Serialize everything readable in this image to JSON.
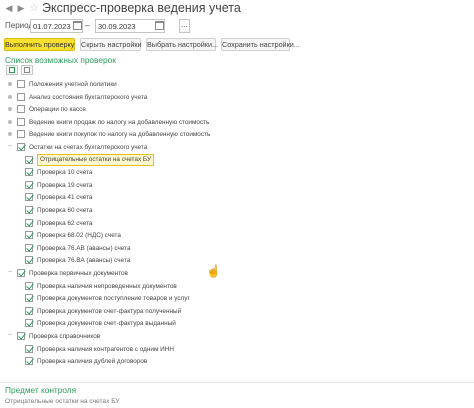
{
  "window": {
    "title": "Экспресс-проверка ведения учета",
    "star_glyph": "☆"
  },
  "period": {
    "label": "Период:",
    "from": "01.07.2023",
    "to": "30.09.2023",
    "dash": "–",
    "more": "..."
  },
  "toolbar": {
    "run": "Выполнить проверку",
    "hide": "Скрыть настройки",
    "choose": "Выбрать настройки...",
    "save": "Сохранить настройки..."
  },
  "checks_title": "Список возможных проверок",
  "tree": [
    {
      "label": "Положения учетной политики",
      "checked": false,
      "level": 0
    },
    {
      "label": "Анализ состояния бухгалтерского учета",
      "checked": false,
      "level": 0
    },
    {
      "label": "Операции по кассе",
      "checked": false,
      "level": 0
    },
    {
      "label": "Ведение книги продаж по налогу на добавленную стоимость",
      "checked": false,
      "level": 0
    },
    {
      "label": "Ведение книги покупок по налогу на добавленную стоимость",
      "checked": false,
      "level": 0
    },
    {
      "label": "Остатки на счетах бухгалтерского учета",
      "checked": true,
      "level": 0,
      "toggle": "−"
    },
    {
      "label": "Отрицательные остатки на счетах БУ",
      "checked": true,
      "level": 1,
      "selected": true
    },
    {
      "label": "Проверка 10 счета",
      "checked": true,
      "level": 1
    },
    {
      "label": "Проверка 19 счета",
      "checked": true,
      "level": 1
    },
    {
      "label": "Проверка 41 счета",
      "checked": true,
      "level": 1
    },
    {
      "label": "Проверка 60 счета",
      "checked": true,
      "level": 1
    },
    {
      "label": "Проверка 62 счета",
      "checked": true,
      "level": 1
    },
    {
      "label": "Проверка 68.02 (НДС) счета",
      "checked": true,
      "level": 1
    },
    {
      "label": "Проверка 76.АВ (авансы) счета",
      "checked": true,
      "level": 1
    },
    {
      "label": "Проверка 76.ВА (авансы) счета",
      "checked": true,
      "level": 1
    },
    {
      "label": "Проверка первичных документов",
      "checked": true,
      "level": 0,
      "toggle": "−"
    },
    {
      "label": "Проверка наличия непроведенных документов",
      "checked": true,
      "level": 1
    },
    {
      "label": "Проверка документов поступление товаров и услуг",
      "checked": true,
      "level": 1
    },
    {
      "label": "Проверка документов счет-фактура полученный",
      "checked": true,
      "level": 1
    },
    {
      "label": "Проверка документов счет-фактура выданный",
      "checked": true,
      "level": 1
    },
    {
      "label": "Проверка справочников",
      "checked": true,
      "level": 0,
      "toggle": "−"
    },
    {
      "label": "Проверка наличия контрагентов с одним ИНН",
      "checked": true,
      "level": 1
    },
    {
      "label": "Проверка наличия дублей договоров",
      "checked": true,
      "level": 1
    }
  ],
  "control": {
    "title": "Предмет контроля",
    "value": "Отрицательные остатки на счетах БУ"
  }
}
